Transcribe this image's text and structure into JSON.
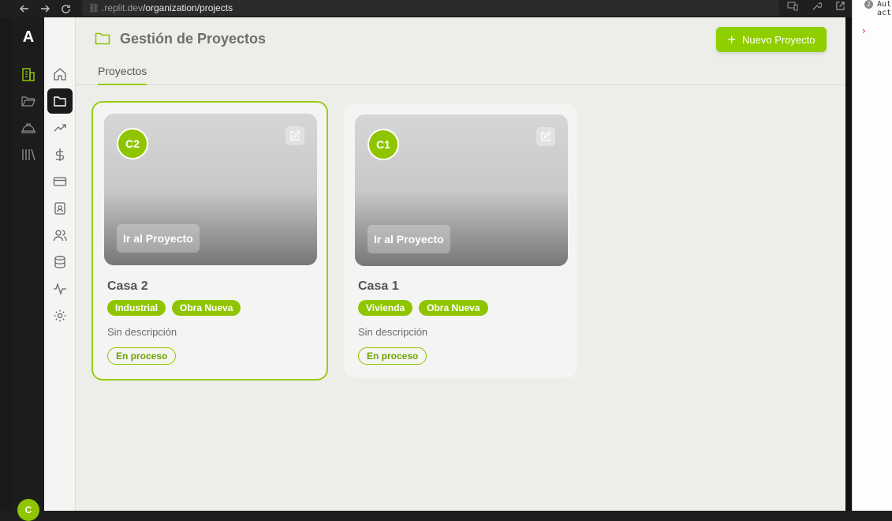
{
  "browser": {
    "url_dim": ".replit.dev",
    "url_path": "/organization/projects"
  },
  "devtools": {
    "badge": "2",
    "line1": "Aut",
    "line2": "act",
    "chevron": "›"
  },
  "rail": {
    "logo": "A",
    "user_initial": "C"
  },
  "header": {
    "title": "Gestión de Proyectos",
    "new_button": "Nuevo Proyecto",
    "new_button_plus": "+"
  },
  "tabs": [
    {
      "label": "Proyectos",
      "active": true
    }
  ],
  "projects": [
    {
      "initials": "C2",
      "go_label": "Ir al Proyecto",
      "name": "Casa 2",
      "tags": [
        "Industrial",
        "Obra Nueva"
      ],
      "description": "Sin descripción",
      "status": "En proceso",
      "selected": true
    },
    {
      "initials": "C1",
      "go_label": "Ir al Proyecto",
      "name": "Casa 1",
      "tags": [
        "Vivienda",
        "Obra Nueva"
      ],
      "description": "Sin descripción",
      "status": "En proceso",
      "selected": false
    }
  ],
  "colors": {
    "accent": "#8fc500",
    "sidebar_active": "#1a1a1a",
    "background": "#ededea"
  },
  "icons": {
    "rail": [
      "buildings-icon",
      "folder-open-icon",
      "helmet-icon",
      "library-icon"
    ],
    "sidebar": [
      "home-icon",
      "folder-icon",
      "trending-icon",
      "dollar-icon",
      "card-icon",
      "contact-icon",
      "users-icon",
      "database-icon",
      "activity-icon",
      "settings-icon"
    ]
  }
}
